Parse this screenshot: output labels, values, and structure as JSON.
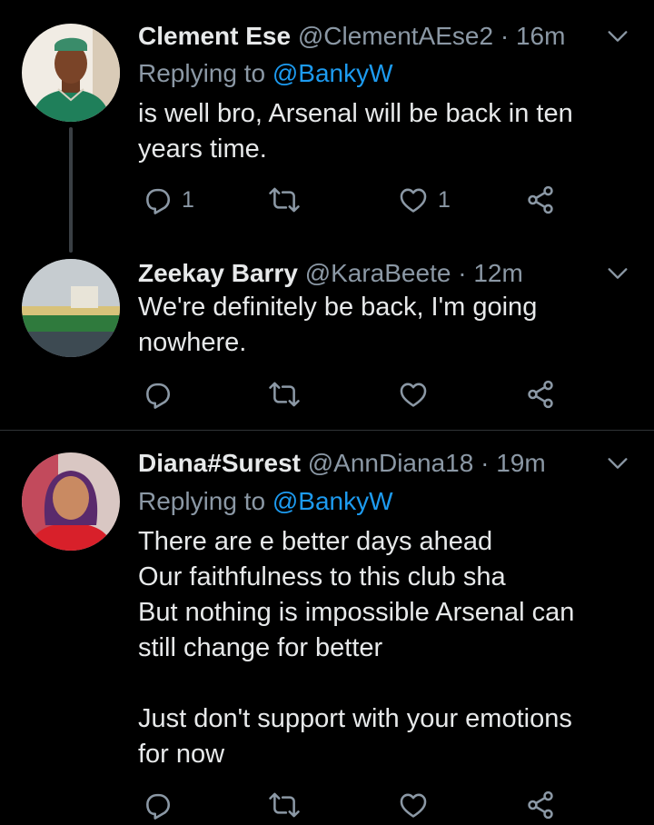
{
  "tweets": [
    {
      "name": "Clement Ese",
      "handle": "@ClementAEse2",
      "separator": "·",
      "time": "16m",
      "replying_label": "Replying to",
      "replying_to": "@BankyW",
      "text_lines": [
        "is well bro, Arsenal will be back in ten",
        "years time."
      ],
      "reply_count": "1",
      "like_count": "1"
    },
    {
      "name": "Zeekay Barry",
      "handle": "@KaraBeete",
      "separator": "·",
      "time": "12m",
      "text_lines": [
        "We're definitely be back,  I'm going",
        "nowhere."
      ]
    },
    {
      "name": "Diana#Surest",
      "handle": "@AnnDiana18",
      "separator": "·",
      "time": "19m",
      "replying_label": "Replying to",
      "replying_to": "@BankyW",
      "text_lines": [
        "There are e better days ahead",
        "Our faithfulness to this  club sha",
        "But nothing is impossible Arsenal can",
        "still change for better",
        "",
        "Just don't support with your emotions",
        "for now"
      ]
    }
  ],
  "colors": {
    "background": "#000000",
    "text": "#e7e9ea",
    "muted": "#8b98a5",
    "link": "#1d9bf0",
    "divider": "#2f3336"
  },
  "icons": [
    "reply-icon",
    "retweet-icon",
    "like-icon",
    "share-icon",
    "chevron-down-icon"
  ]
}
